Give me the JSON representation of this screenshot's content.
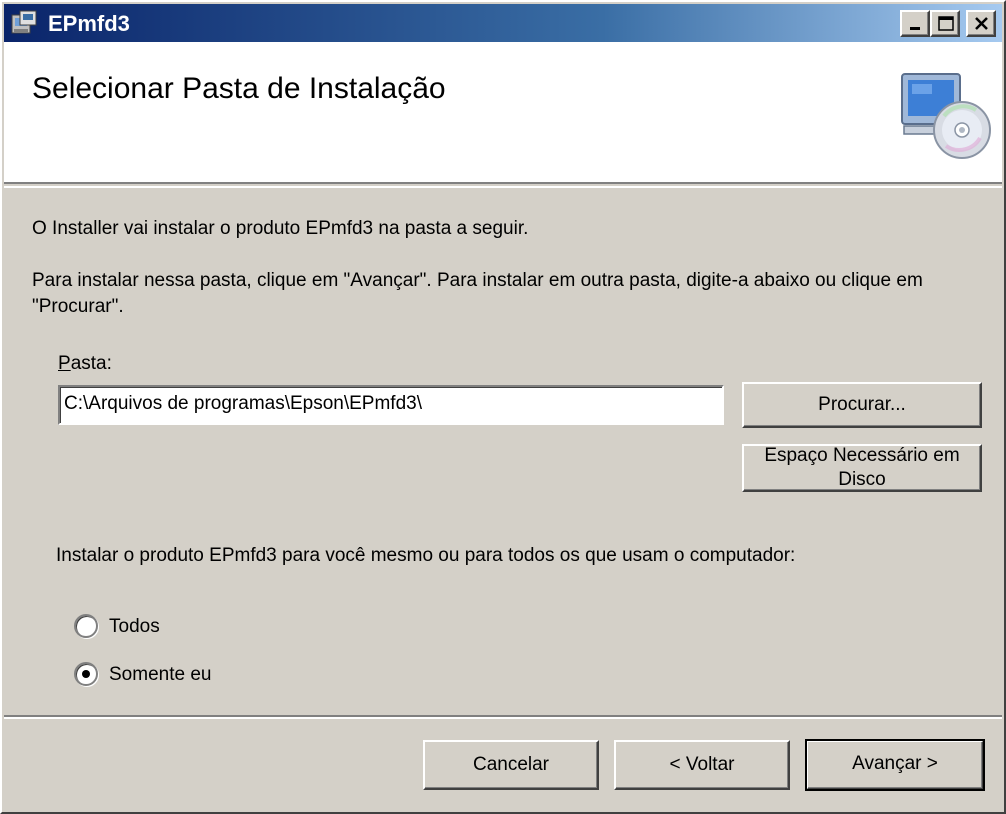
{
  "window": {
    "title": "EPmfd3",
    "controls": [
      "minimize",
      "maximize",
      "close"
    ]
  },
  "banner": {
    "heading": "Selecionar Pasta de Instalação",
    "icon": "computer-cd-icon"
  },
  "body": {
    "info_text": "O Installer vai instalar o produto EPmfd3 na pasta a seguir.",
    "instructions_text": "Para instalar nessa pasta, clique em \"Avançar\". Para instalar em outra pasta, digite-a abaixo ou clique em \"Procurar\".",
    "folder_label_mnemonic": "P",
    "folder_label_rest": "asta:",
    "folder_value": "C:\\Arquivos de programas\\Epson\\EPmfd3\\",
    "browse_label": "Procurar...",
    "disk_cost_label": "Espaço Necessário em Disco",
    "install_for_text": "Instalar o produto EPmfd3 para você mesmo ou para todos os que usam o computador:",
    "radio_all_label": "Todos",
    "radio_me_label": "Somente eu",
    "selected_option": "Somente eu"
  },
  "footer": {
    "cancel_label": "Cancelar",
    "back_label": "< Voltar",
    "next_label": "Avançar >"
  },
  "colors": {
    "titlebar_start": "#0a246a",
    "titlebar_end": "#a6caf0",
    "dialog_bg": "#d4d0c8"
  }
}
